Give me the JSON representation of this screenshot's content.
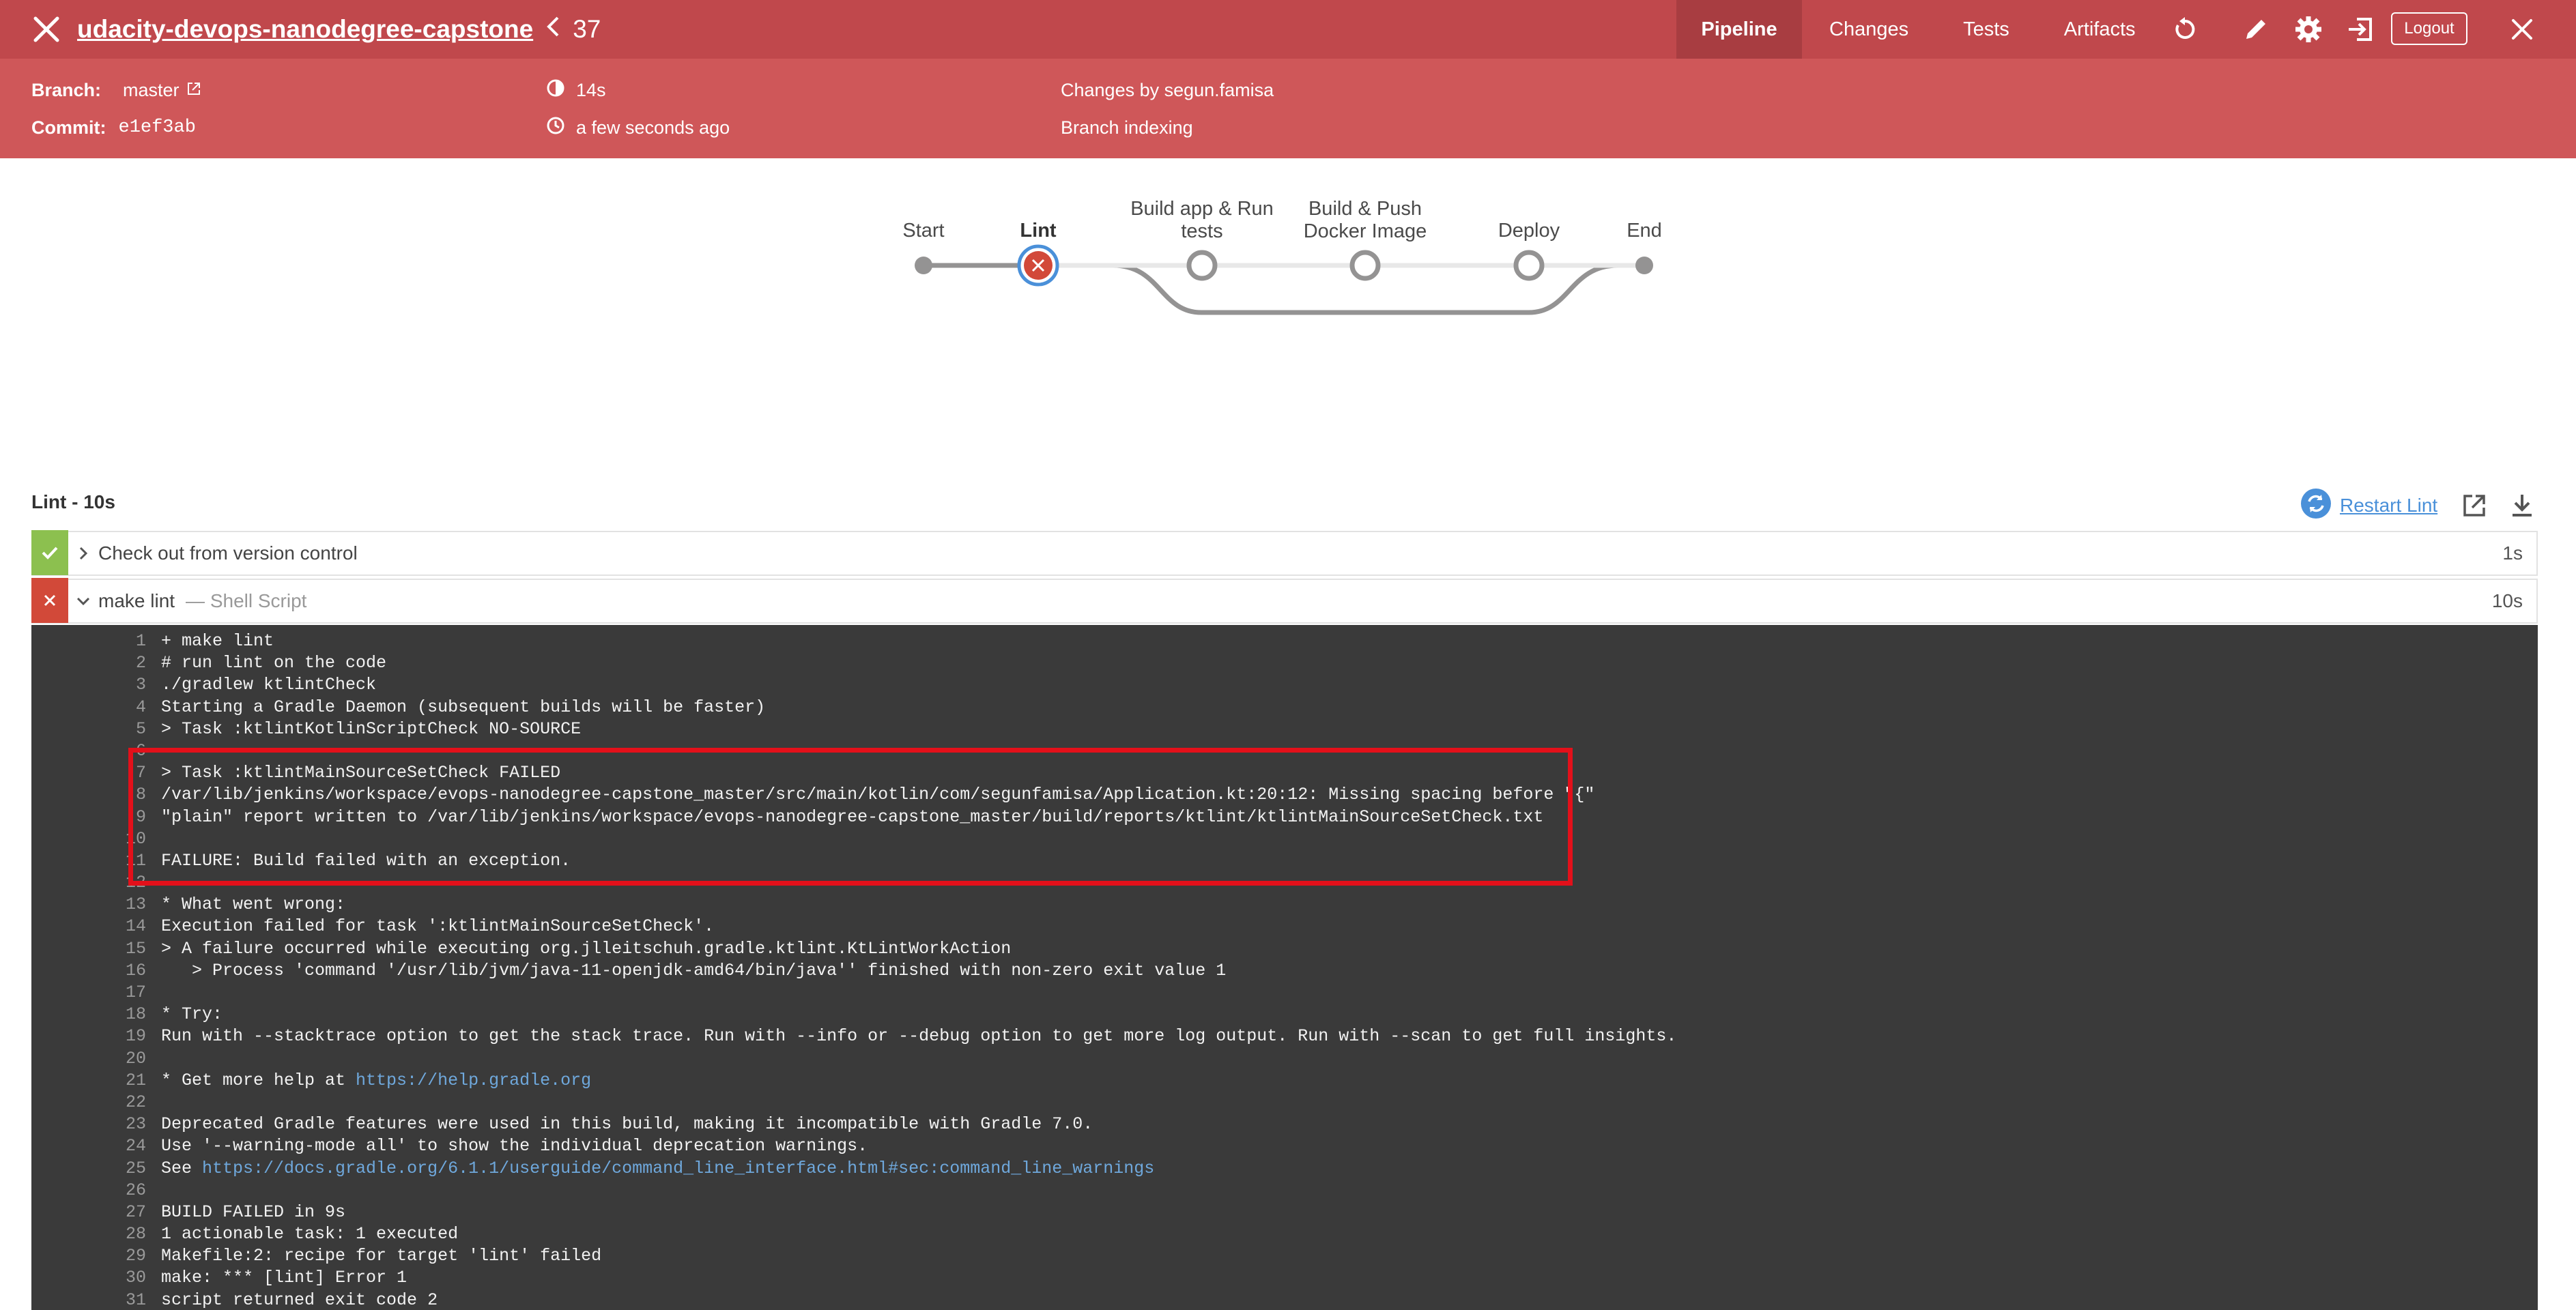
{
  "header": {
    "job_name": "udacity-devops-nanodegree-capstone",
    "run_number": "37",
    "tabs": [
      {
        "label": "Pipeline",
        "active": true
      },
      {
        "label": "Changes",
        "active": false
      },
      {
        "label": "Tests",
        "active": false
      },
      {
        "label": "Artifacts",
        "active": false
      }
    ],
    "logout_label": "Logout",
    "icons": [
      "close-icon",
      "replay-icon",
      "edit-pencil-icon",
      "settings-gear-icon",
      "classic-ui-exit-icon",
      "close-icon"
    ]
  },
  "info": {
    "branch_label": "Branch:",
    "branch_value": "master",
    "commit_label": "Commit:",
    "commit_value": "e1ef3ab",
    "duration": "14s",
    "started": "a few seconds ago",
    "changes": "Changes by segun.famisa",
    "cause": "Branch indexing"
  },
  "pipeline": {
    "stages": [
      {
        "label": "Start",
        "status": "start"
      },
      {
        "label": "Lint",
        "status": "failed",
        "selected": true
      },
      {
        "label": "Build app & Run tests",
        "status": "not-built"
      },
      {
        "label": "Build & Push Docker Image",
        "status": "not-built"
      },
      {
        "label": "Deploy",
        "status": "not-built"
      },
      {
        "label": "End",
        "status": "end"
      }
    ]
  },
  "stage_detail": {
    "title": "Lint - 10s",
    "restart_label": "Restart Lint",
    "steps": [
      {
        "name": "Check out from version control",
        "sub": "",
        "duration": "1s",
        "status": "success",
        "expanded": false
      },
      {
        "name": "make lint",
        "sub": "— Shell Script",
        "duration": "10s",
        "status": "failed",
        "expanded": true
      }
    ]
  },
  "log": [
    {
      "n": "1",
      "text": "+ make lint"
    },
    {
      "n": "2",
      "text": "# run lint on the code"
    },
    {
      "n": "3",
      "text": "./gradlew ktlintCheck"
    },
    {
      "n": "4",
      "text": "Starting a Gradle Daemon (subsequent builds will be faster)"
    },
    {
      "n": "5",
      "text": "> Task :ktlintKotlinScriptCheck NO-SOURCE"
    },
    {
      "n": "6",
      "text": ""
    },
    {
      "n": "7",
      "text": "> Task :ktlintMainSourceSetCheck FAILED"
    },
    {
      "n": "8",
      "text": "/var/lib/jenkins/workspace/evops-nanodegree-capstone_master/src/main/kotlin/com/segunfamisa/Application.kt:20:12: Missing spacing before \"{\""
    },
    {
      "n": "9",
      "text": "\"plain\" report written to /var/lib/jenkins/workspace/evops-nanodegree-capstone_master/build/reports/ktlint/ktlintMainSourceSetCheck.txt"
    },
    {
      "n": "10",
      "text": ""
    },
    {
      "n": "11",
      "text": "FAILURE: Build failed with an exception."
    },
    {
      "n": "12",
      "text": ""
    },
    {
      "n": "13",
      "text": "* What went wrong:"
    },
    {
      "n": "14",
      "text": "Execution failed for task ':ktlintMainSourceSetCheck'."
    },
    {
      "n": "15",
      "text": "> A failure occurred while executing org.jlleitschuh.gradle.ktlint.KtLintWorkAction"
    },
    {
      "n": "16",
      "text": "   > Process 'command '/usr/lib/jvm/java-11-openjdk-amd64/bin/java'' finished with non-zero exit value 1"
    },
    {
      "n": "17",
      "text": ""
    },
    {
      "n": "18",
      "text": "* Try:"
    },
    {
      "n": "19",
      "text": "Run with --stacktrace option to get the stack trace. Run with --info or --debug option to get more log output. Run with --scan to get full insights."
    },
    {
      "n": "20",
      "text": ""
    },
    {
      "n": "21",
      "text": "* Get more help at ",
      "link": "https://help.gradle.org"
    },
    {
      "n": "22",
      "text": ""
    },
    {
      "n": "23",
      "text": "Deprecated Gradle features were used in this build, making it incompatible with Gradle 7.0."
    },
    {
      "n": "24",
      "text": "Use '--warning-mode all' to show the individual deprecation warnings."
    },
    {
      "n": "25",
      "text": "See ",
      "link": "https://docs.gradle.org/6.1.1/userguide/command_line_interface.html#sec:command_line_warnings"
    },
    {
      "n": "26",
      "text": ""
    },
    {
      "n": "27",
      "text": "BUILD FAILED in 9s"
    },
    {
      "n": "28",
      "text": "1 actionable task: 1 executed"
    },
    {
      "n": "29",
      "text": "Makefile:2: recipe for target 'lint' failed"
    },
    {
      "n": "30",
      "text": "make: *** [lint] Error 1"
    },
    {
      "n": "31",
      "text": "script returned exit code 2"
    }
  ]
}
